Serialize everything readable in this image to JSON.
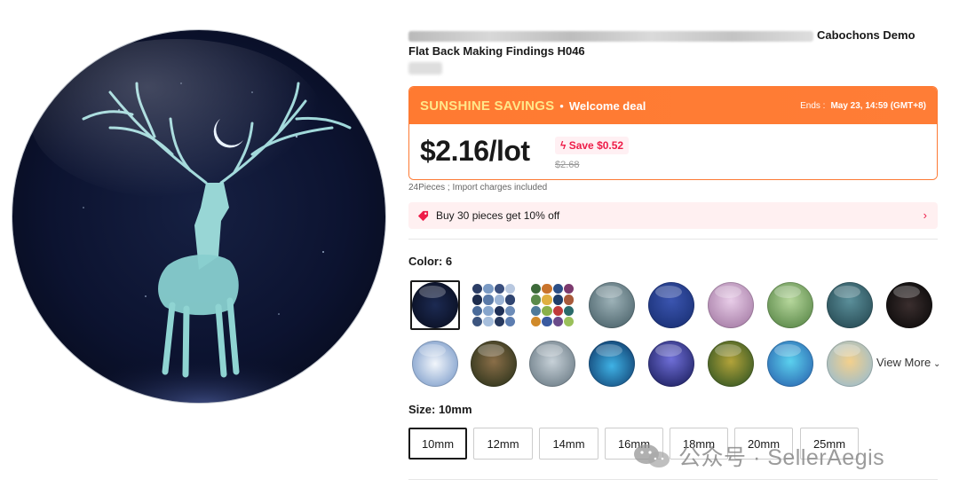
{
  "product": {
    "title_visible": "Cabochons Demo",
    "title_line2": "Flat Back Making Findings H046"
  },
  "deal": {
    "brand": "SUNSHINE SAVINGS",
    "dot": "•",
    "welcome": "Welcome deal",
    "ends_label": "Ends :",
    "ends_value": "May 23, 14:59 (GMT+8)",
    "price": "$2.16/lot",
    "save": "Save $0.52",
    "original_price": "$2.68",
    "accent_color": "#ff7a31",
    "save_color": "#ee1c48"
  },
  "pieces_note": "24Pieces ; Import charges included",
  "promo": {
    "text": "Buy 30 pieces get 10% off",
    "chevron": "›"
  },
  "color": {
    "label": "Color: 6",
    "view_more": "View More",
    "view_more_icon": "chevron-down-icon",
    "swatches": [
      "deer-night",
      "grid-collage-blue",
      "grid-collage-multi",
      "tree-deer-grey",
      "deer-starry",
      "deer-pink",
      "deer-green",
      "deer-teal-antlers",
      "deer-red-black",
      "deer-blue-porcelain",
      "deer-portrait-brown",
      "deer-portrait-grey",
      "deer-aurora",
      "deer-moon",
      "deer-forest-green",
      "deer-fantasy-blue",
      "deer-golden"
    ]
  },
  "size": {
    "label": "Size: 10mm",
    "options": [
      "10mm",
      "12mm",
      "14mm",
      "16mm",
      "18mm",
      "20mm",
      "25mm"
    ],
    "selected_index": 0
  },
  "watermark": {
    "text": "公众号 · SellerAegis"
  }
}
